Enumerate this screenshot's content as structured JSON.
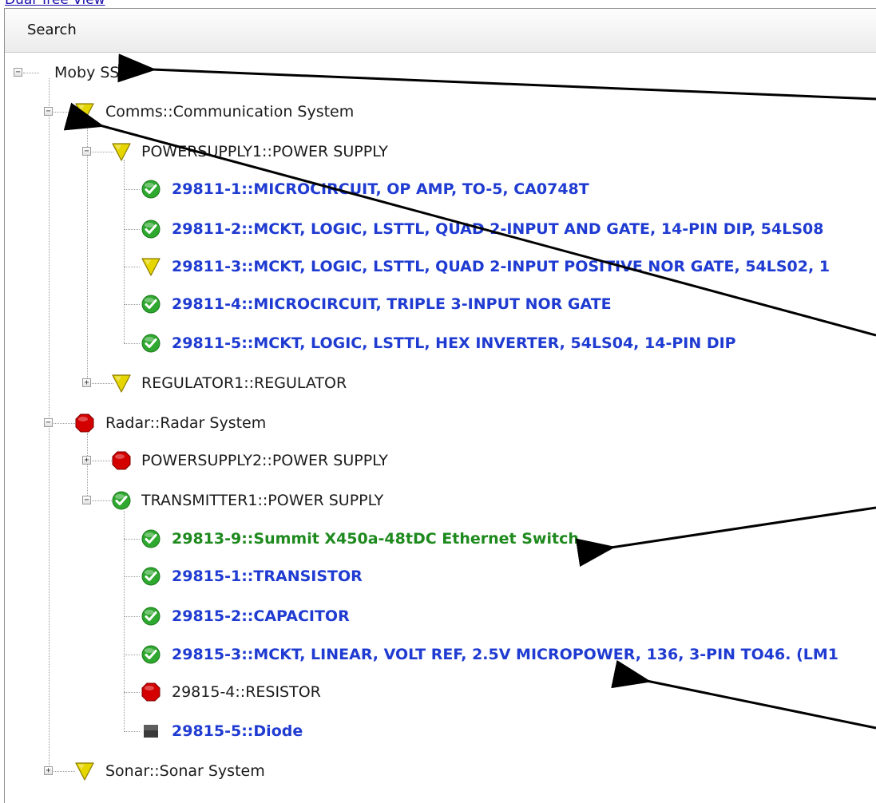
{
  "top_link": "Dual Tree View",
  "search_label": "Search",
  "tree": [
    {
      "label": "Moby SS",
      "status": "none",
      "toggle": "−",
      "style": "plain"
    },
    {
      "label": "Comms::Communication System",
      "status": "warning",
      "toggle": "−",
      "style": "plain"
    },
    {
      "label": "POWERSUPPLY1::POWER SUPPLY",
      "status": "warning",
      "toggle": "−",
      "style": "plain"
    },
    {
      "label": "29811-1::MICROCIRCUIT, OP AMP, TO-5, CA0748T",
      "status": "ok",
      "toggle": "",
      "style": "blue"
    },
    {
      "label": "29811-2::MCKT, LOGIC, LSTTL, QUAD 2-INPUT AND GATE, 14-PIN DIP, 54LS08",
      "status": "ok",
      "toggle": "",
      "style": "blue"
    },
    {
      "label": "29811-3::MCKT, LOGIC, LSTTL, QUAD 2-INPUT POSITIVE NOR GATE, 54LS02, 1",
      "status": "warning",
      "toggle": "",
      "style": "blue"
    },
    {
      "label": "29811-4::MICROCIRCUIT, TRIPLE 3-INPUT NOR GATE",
      "status": "ok",
      "toggle": "",
      "style": "blue"
    },
    {
      "label": "29811-5::MCKT, LOGIC, LSTTL, HEX INVERTER, 54LS04, 14-PIN DIP",
      "status": "ok",
      "toggle": "",
      "style": "blue"
    },
    {
      "label": "REGULATOR1::REGULATOR",
      "status": "warning",
      "toggle": "+",
      "style": "plain"
    },
    {
      "label": "Radar::Radar System",
      "status": "error",
      "toggle": "−",
      "style": "plain"
    },
    {
      "label": "POWERSUPPLY2::POWER SUPPLY",
      "status": "error",
      "toggle": "+",
      "style": "plain"
    },
    {
      "label": "TRANSMITTER1::POWER SUPPLY",
      "status": "ok",
      "toggle": "−",
      "style": "plain"
    },
    {
      "label": "29813-9::Summit X450a-48tDC Ethernet Switch",
      "status": "ok",
      "toggle": "",
      "style": "green"
    },
    {
      "label": "29815-1::TRANSISTOR",
      "status": "ok",
      "toggle": "",
      "style": "blue"
    },
    {
      "label": "29815-2::CAPACITOR",
      "status": "ok",
      "toggle": "",
      "style": "blue"
    },
    {
      "label": "29815-3::MCKT, LINEAR, VOLT REF, 2.5V MICROPOWER, 136, 3-PIN TO46. (LM1",
      "status": "ok",
      "toggle": "",
      "style": "blue"
    },
    {
      "label": "29815-4::RESISTOR",
      "status": "error",
      "toggle": "",
      "style": "plain"
    },
    {
      "label": "29815-5::Diode",
      "status": "unknown",
      "toggle": "",
      "style": "blue"
    },
    {
      "label": "Sonar::Sonar System",
      "status": "warning",
      "toggle": "+",
      "style": "plain"
    }
  ],
  "colors": {
    "ok": "#2ea82e",
    "warning": "#e6d600",
    "error": "#d40000",
    "unknown": "#3a3a3a",
    "label_blue": "#1f3bd1",
    "label_green": "#1e8a1e"
  }
}
